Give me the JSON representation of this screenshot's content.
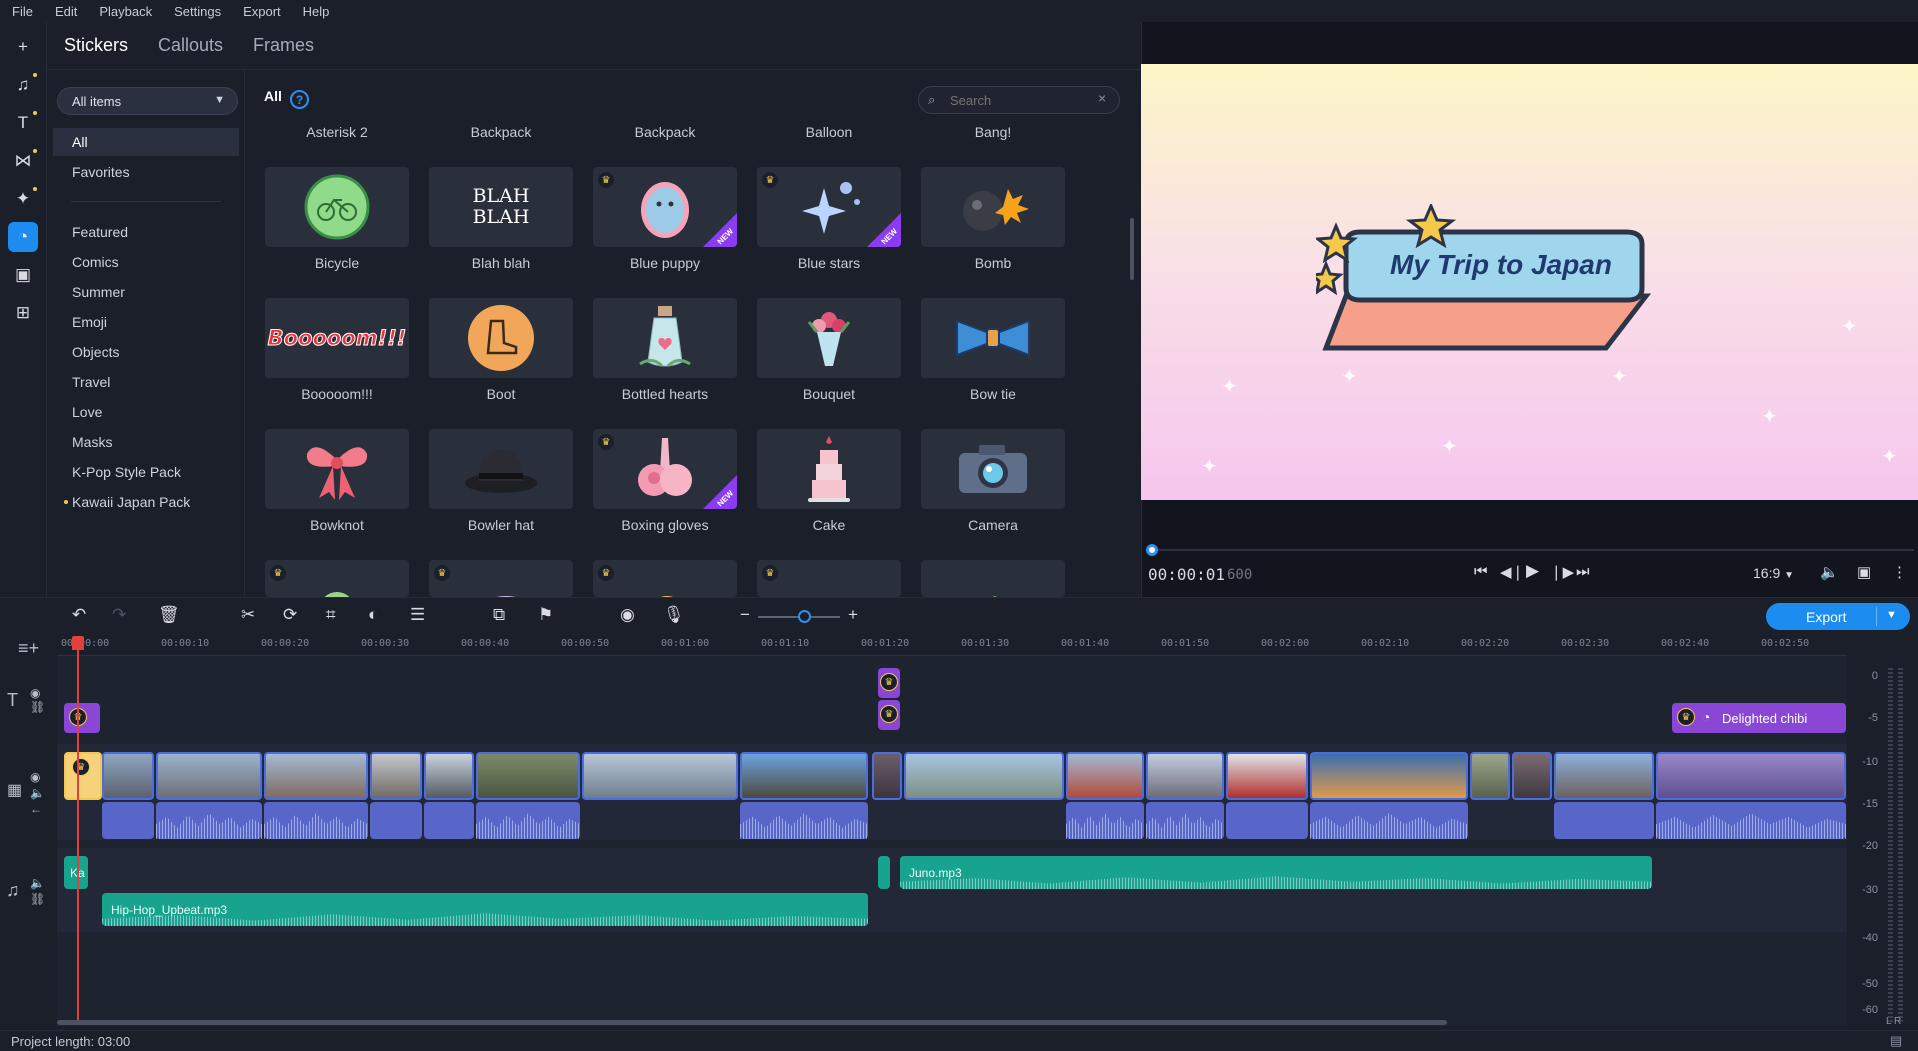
{
  "menu": [
    "File",
    "Edit",
    "Playback",
    "Settings",
    "Export",
    "Help"
  ],
  "rail": [
    {
      "name": "add-media-icon",
      "glyph": "+"
    },
    {
      "name": "music-icon",
      "glyph": "♫"
    },
    {
      "name": "titles-icon",
      "glyph": "T"
    },
    {
      "name": "transitions-icon",
      "glyph": "⋈"
    },
    {
      "name": "filters-icon",
      "glyph": "✦"
    },
    {
      "name": "stickers-icon",
      "glyph": "◔"
    },
    {
      "name": "more-tools-icon",
      "glyph": "▣"
    },
    {
      "name": "plugins-icon",
      "glyph": "⊞"
    }
  ],
  "tabs": [
    "Stickers",
    "Callouts",
    "Frames"
  ],
  "category_select": "All items",
  "categories": {
    "all": "All",
    "favorites": "Favorites",
    "packs": [
      "Featured",
      "Comics",
      "Summer",
      "Emoji",
      "Objects",
      "Travel",
      "Love",
      "Masks",
      "K-Pop Style Pack",
      "Kawaii Japan Pack"
    ]
  },
  "grid": {
    "heading": "All",
    "help": "?",
    "search_placeholder": "Search",
    "top_labels": [
      "Asterisk 2",
      "Backpack",
      "Backpack",
      "Balloon",
      "Bang!"
    ],
    "items": [
      "Bicycle",
      "Blah blah",
      "Blue puppy",
      "Blue stars",
      "Bomb",
      "Booooom!!!",
      "Boot",
      "Bottled hearts",
      "Bouquet",
      "Bow tie",
      "Bowknot",
      "Bowler hat",
      "Boxing gloves",
      "Cake",
      "Camera"
    ],
    "new_badge": "NEW",
    "blah_art": "BLAH BLAH",
    "boom_art": "Booooom!!!"
  },
  "preview": {
    "title_text": "My Trip to Japan",
    "timecode": "00:00:01",
    "timecode_ms": "600",
    "aspect": "16:9",
    "progress": 0.01
  },
  "toolbar": {
    "export_label": "Export"
  },
  "timeline": {
    "ticks": [
      "00:00:00",
      "00:00:10",
      "00:00:20",
      "00:00:30",
      "00:00:40",
      "00:00:50",
      "00:01:00",
      "00:01:10",
      "00:01:20",
      "00:01:30",
      "00:01:40",
      "00:01:50",
      "00:02:00",
      "00:02:10",
      "00:02:20",
      "00:02:30",
      "00:02:40",
      "00:02:50"
    ],
    "sticker_clip": "Delighted chibi",
    "music_1": "Juno.mp3",
    "music_2": "Hip-Hop_Upbeat.mp3",
    "music_short": "Ka",
    "meter_labels": [
      "0",
      "-5",
      "-10",
      "-15",
      "-20",
      "-30",
      "-40",
      "-50",
      "-60"
    ],
    "meter_lr": "L R"
  },
  "status": {
    "project_length": "Project length: 03:00"
  },
  "colors": {
    "accent": "#1d8cf0",
    "sticker_purple": "#8a47d6",
    "music_teal": "#18a38e",
    "audio_blue": "#5866c9",
    "playhead": "#e0413a"
  }
}
